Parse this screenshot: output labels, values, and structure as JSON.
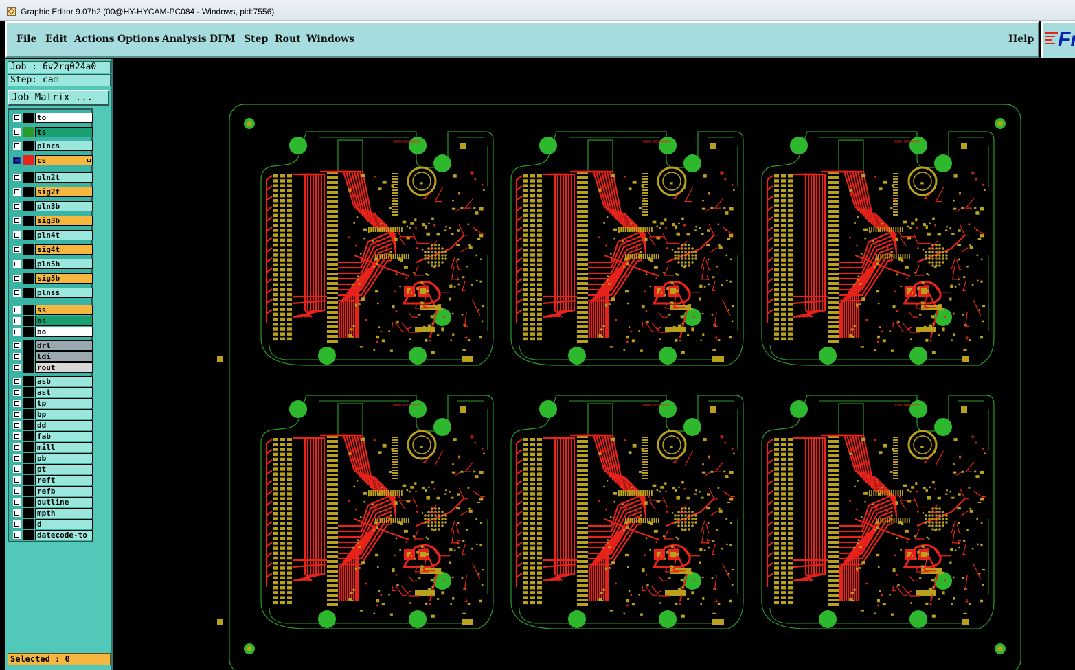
{
  "window": {
    "title": "Graphic Editor 9.07b2 (00@HY-HYCAM-PC084 - Windows, pid:7556)"
  },
  "menu": {
    "items": [
      {
        "label": "File"
      },
      {
        "label": "Edit"
      },
      {
        "label": "Actions"
      },
      {
        "label": "Options"
      },
      {
        "label": "Analysis"
      },
      {
        "label": "DFM"
      },
      {
        "label": "Step"
      },
      {
        "label": "Rout"
      },
      {
        "label": "Windows"
      }
    ],
    "help": "Help"
  },
  "logo_text": "Fr",
  "info": {
    "job": "Job : 6v2rq024a0",
    "step": "Step: cam",
    "job_matrix_button": "Job Matrix ..."
  },
  "layers": [
    {
      "name": "to",
      "color": "#ffffff",
      "swatch": "#000000"
    },
    {
      "name": "ts",
      "color": "#1aa070",
      "swatch": "#2a9a2a"
    },
    {
      "name": "plncs",
      "color": "#9be7de",
      "swatch": "#000000"
    },
    {
      "name": "cs",
      "color": "#f5b73f",
      "swatch": "#e8231b",
      "active": true
    },
    {
      "name": "pln2t",
      "color": "#9be7de",
      "swatch": "#000000"
    },
    {
      "name": "sig2t",
      "color": "#f5b73f",
      "swatch": "#000000"
    },
    {
      "name": "pln3b",
      "color": "#9be7de",
      "swatch": "#000000"
    },
    {
      "name": "sig3b",
      "color": "#f5b73f",
      "swatch": "#000000"
    },
    {
      "name": "pln4t",
      "color": "#9be7de",
      "swatch": "#000000"
    },
    {
      "name": "sig4t",
      "color": "#f5b73f",
      "swatch": "#000000"
    },
    {
      "name": "pln5b",
      "color": "#9be7de",
      "swatch": "#000000"
    },
    {
      "name": "sig5b",
      "color": "#f5b73f",
      "swatch": "#000000"
    },
    {
      "name": "plnss",
      "color": "#9be7de",
      "swatch": "#000000"
    },
    {
      "name": "ss",
      "color": "#f5b73f",
      "swatch": "#000000"
    },
    {
      "name": "bs",
      "color": "#1aa070",
      "swatch": "#000000"
    },
    {
      "name": "bo",
      "color": "#ffffff",
      "swatch": "#000000"
    },
    {
      "name": "drl",
      "color": "#9aa9b0",
      "swatch": "#000000"
    },
    {
      "name": "ldi",
      "color": "#9aa9b0",
      "swatch": "#000000"
    },
    {
      "name": "rout",
      "color": "#d8d8d8",
      "swatch": "#000000"
    },
    {
      "name": "asb",
      "color": "#9be7de",
      "swatch": "#000000"
    },
    {
      "name": "ast",
      "color": "#9be7de",
      "swatch": "#000000"
    },
    {
      "name": "tp",
      "color": "#9be7de",
      "swatch": "#000000"
    },
    {
      "name": "bp",
      "color": "#9be7de",
      "swatch": "#000000"
    },
    {
      "name": "dd",
      "color": "#9be7de",
      "swatch": "#000000"
    },
    {
      "name": "fab",
      "color": "#9be7de",
      "swatch": "#000000"
    },
    {
      "name": "mill",
      "color": "#9be7de",
      "swatch": "#000000"
    },
    {
      "name": "pb",
      "color": "#9be7de",
      "swatch": "#000000"
    },
    {
      "name": "pt",
      "color": "#9be7de",
      "swatch": "#000000"
    },
    {
      "name": "reft",
      "color": "#9be7de",
      "swatch": "#000000"
    },
    {
      "name": "refb",
      "color": "#9be7de",
      "swatch": "#000000"
    },
    {
      "name": "outline",
      "color": "#9be7de",
      "swatch": "#000000"
    },
    {
      "name": "mpth",
      "color": "#9be7de",
      "swatch": "#000000"
    },
    {
      "name": "d",
      "color": "#9be7de",
      "swatch": "#000000"
    },
    {
      "name": "datecode-to",
      "color": "#9be7de",
      "swatch": "#000000"
    }
  ],
  "status": {
    "selected": "Selected : 0"
  },
  "board": {
    "copper_color": "#e8231b",
    "pad_color": "#b8a11c",
    "fiducial_color": "#2eb82e",
    "outline_color": "#2a9a2a",
    "units": 6
  }
}
